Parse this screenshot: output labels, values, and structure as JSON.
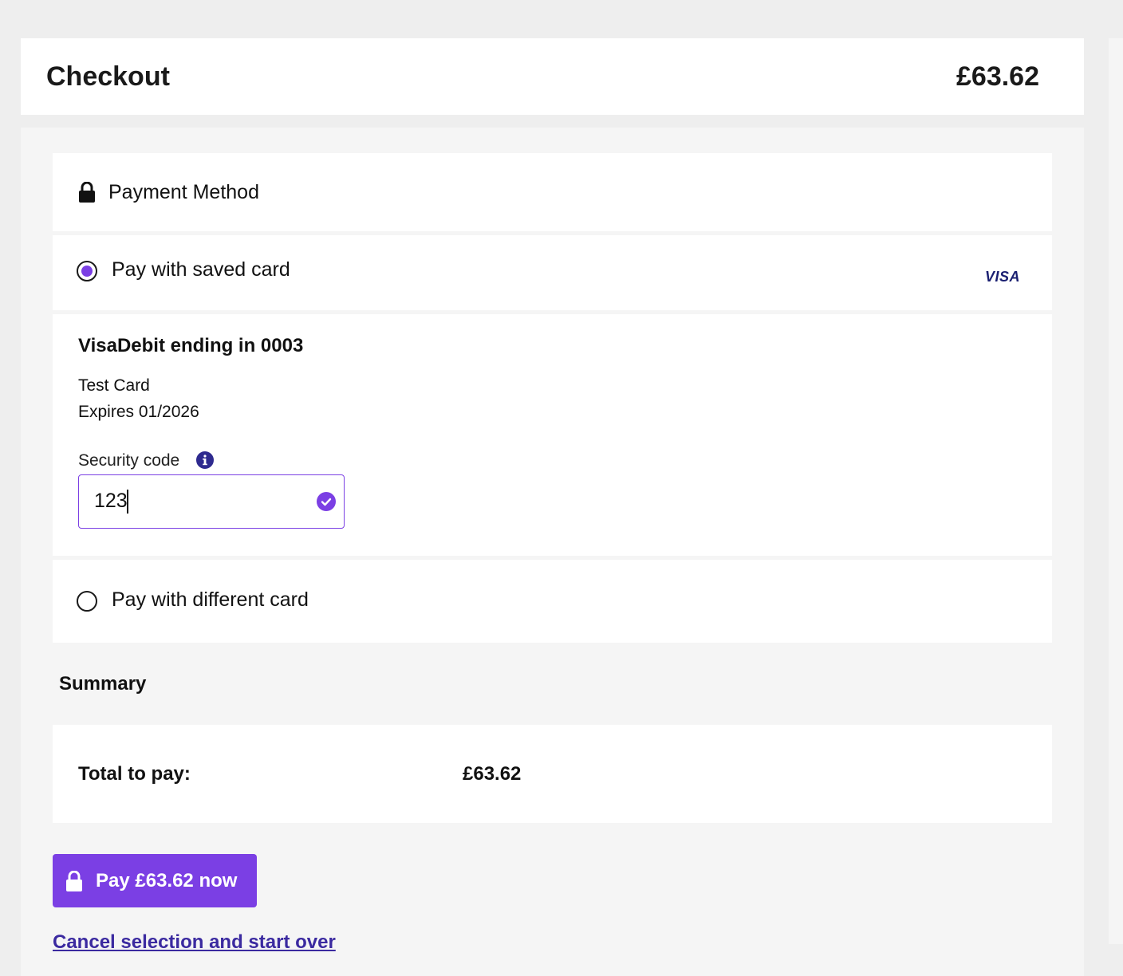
{
  "header": {
    "title": "Checkout",
    "amount": "£63.62"
  },
  "payment_method": {
    "title": "Payment Method",
    "icon": "lock-icon"
  },
  "saved_card_option": {
    "label": "Pay with saved card",
    "selected": true,
    "brand_logo": "VISA"
  },
  "saved_card": {
    "name": "VisaDebit ending in 0003",
    "holder": "Test Card",
    "expiry": "Expires 01/2026",
    "security_code_label": "Security code",
    "security_code_value": "123"
  },
  "different_card_option": {
    "label": "Pay with different card",
    "selected": false
  },
  "summary": {
    "title": "Summary",
    "total_label": "Total to pay:",
    "total_value": "£63.62"
  },
  "actions": {
    "pay_label": "Pay £63.62 now",
    "cancel_label": "Cancel selection and start over"
  },
  "colors": {
    "accent": "#7b3fe4",
    "link": "#3b2aa0",
    "visa": "#1a1f71",
    "panel_bg": "#f5f5f5",
    "page_bg": "#eeeeee"
  }
}
